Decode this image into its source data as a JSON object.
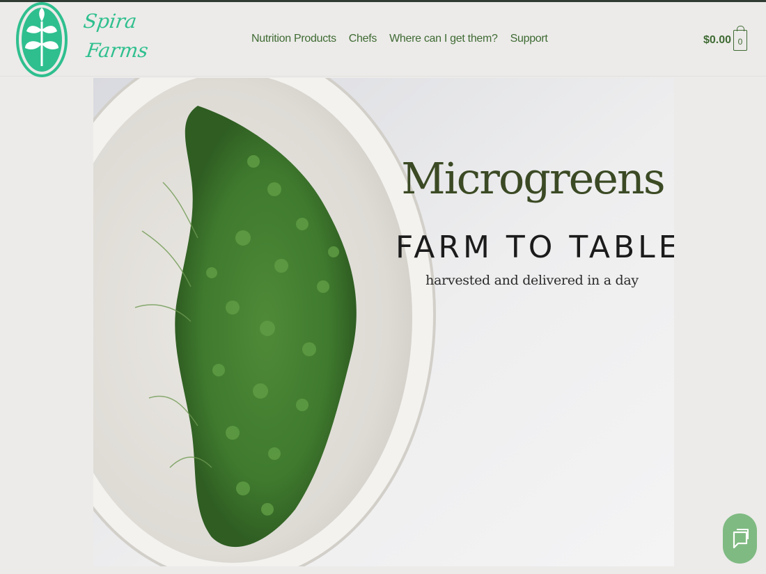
{
  "brand": {
    "line1": "Spira",
    "line2": "Farms",
    "color": "#2fbf8f"
  },
  "nav": {
    "items": [
      "Nutrition Products",
      "Chefs",
      "Where can I get them?",
      "Support"
    ]
  },
  "cart": {
    "total": "$0.00",
    "count": "0"
  },
  "hero": {
    "title": "Microgreens",
    "subtitle": "FARM TO TABLE",
    "tagline": "harvested and delivered in a day"
  },
  "colors": {
    "nav_text": "#3f6a33",
    "chat_button": "#7fba82",
    "background": "#ecebe9"
  },
  "icons": {
    "logo": "sprout-icon",
    "cart": "shopping-bag-icon",
    "chat": "chat-icon"
  }
}
